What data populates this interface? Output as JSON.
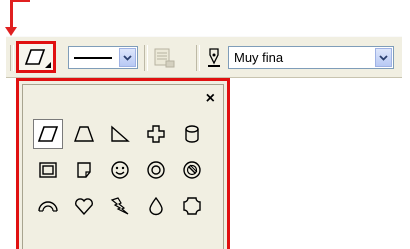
{
  "toolbar": {
    "shape_button": {
      "icon": "parallelogram-icon"
    },
    "line_style_combo": {
      "icon": "solid-line-icon"
    },
    "disabled_button": {
      "icon": "fill-icon"
    },
    "pen_icon": {
      "icon": "pen-nib-icon"
    },
    "line_width_combo": {
      "value": "Muy fina"
    }
  },
  "panel": {
    "close_label": "×",
    "rows": [
      [
        "parallelogram",
        "trapezoid",
        "right-triangle",
        "cross",
        "cylinder"
      ],
      [
        "frame",
        "folded-corner",
        "smiley",
        "donut",
        "no-symbol"
      ],
      [
        "arc",
        "heart",
        "lightning",
        "drop",
        "plaque"
      ]
    ],
    "selected": "parallelogram"
  },
  "colors": {
    "highlight": "#e01010",
    "toolbar_bg": "#f1efe2",
    "combo_border": "#7f9db9"
  }
}
